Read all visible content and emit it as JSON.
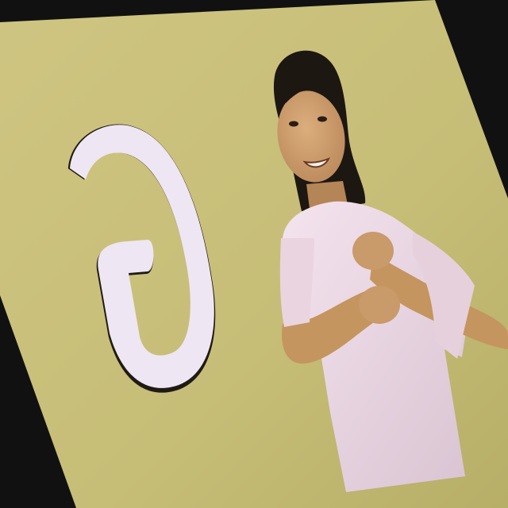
{
  "scene": {
    "background_color": "#111111",
    "wall_color": "#c9c07a",
    "wall_highlight": "#d6cd8a",
    "letter_fill": "#eee6f2",
    "letter_outline": "#1f1a14",
    "shirt_color": "#efdbe6",
    "hair_color": "#1d1712",
    "skin_color": "#c99a6a",
    "letter_glyph": "G"
  }
}
